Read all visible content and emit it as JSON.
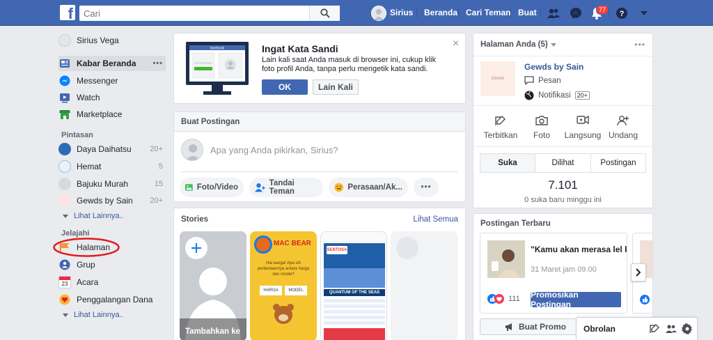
{
  "header": {
    "logo_letter": "f",
    "search_placeholder": "Cari",
    "profile_name": "Sirius",
    "nav": [
      "Beranda",
      "Cari Teman",
      "Buat"
    ],
    "notification_count": "77"
  },
  "left_nav": {
    "profile": "Sirius Vega",
    "main_items": [
      {
        "label": "Kabar Beranda",
        "icon": "news-feed-icon"
      },
      {
        "label": "Messenger",
        "icon": "messenger-icon"
      },
      {
        "label": "Watch",
        "icon": "watch-icon"
      },
      {
        "label": "Marketplace",
        "icon": "marketplace-icon"
      }
    ],
    "more_dots": "•••",
    "shortcuts_title": "Pintasan",
    "shortcuts": [
      {
        "label": "Daya Daihatsu",
        "count": "20+"
      },
      {
        "label": "Hemat",
        "count": "5"
      },
      {
        "label": "Bajuku Murah",
        "count": "15"
      },
      {
        "label": "Gewds by Sain",
        "count": "20+"
      }
    ],
    "see_more_1": "Lihat Lainnya..",
    "explore_title": "Jelajahi",
    "explore": [
      {
        "label": "Halaman",
        "icon": "flag-icon"
      },
      {
        "label": "Grup",
        "icon": "groups-icon"
      },
      {
        "label": "Acara",
        "icon": "calendar-icon"
      },
      {
        "label": "Penggalangan Dana",
        "icon": "fundraiser-icon"
      }
    ],
    "see_more_2": "Lihat Lainnya..",
    "calendar_day": "23"
  },
  "password_card": {
    "title": "Ingat Kata Sandi",
    "body": "Lain kali saat Anda masuk di browser ini, cukup klik foto profil Anda, tanpa perlu mengetik kata sandi.",
    "ok": "OK",
    "later": "Lain Kali",
    "monitor_label": "facebook",
    "close": "×"
  },
  "composer": {
    "title": "Buat Postingan",
    "placeholder": "Apa yang Anda pikirkan, Sirius?",
    "actions": [
      "Foto/Video",
      "Tandai Teman",
      "Perasaan/Ak..."
    ],
    "more": "•••"
  },
  "stories": {
    "title": "Stories",
    "see_all": "Lihat Semua",
    "add_label": "Tambahkan ke",
    "story2": {
      "brand": "MAC BEAR",
      "question": "Hai warga! Apa sih perbedaannya antara harga dan model?",
      "tag1": "HARGA",
      "tag2": "MODEL"
    },
    "story3": {
      "brand": "SENTOSA",
      "caption": "QUANTUM OF THE SEAS"
    }
  },
  "right_panel": {
    "header": "Halaman Anda (5)",
    "dots": "•••",
    "page_name": "Gewds by Sain",
    "page_logo": "Gewds",
    "messages": "Pesan",
    "notifications": "Notifikasi",
    "notif_badge": "20+",
    "actions": [
      "Terbitkan",
      "Foto",
      "Langsung",
      "Undang"
    ],
    "tabs": [
      "Suka",
      "Dilihat",
      "Postingan"
    ],
    "likes_count": "7.101",
    "likes_sub": "0 suka baru minggu ini",
    "recent_title": "Postingan Terbaru",
    "post_text": "\"Kamu akan merasa lel kalau terus memikirkan",
    "post_date": "31 Maret jam 09.00",
    "reactions": "111",
    "promote": "Promosikan Postingan",
    "create_promo": "Buat Promo"
  },
  "chat": {
    "label": "Obrolan"
  }
}
